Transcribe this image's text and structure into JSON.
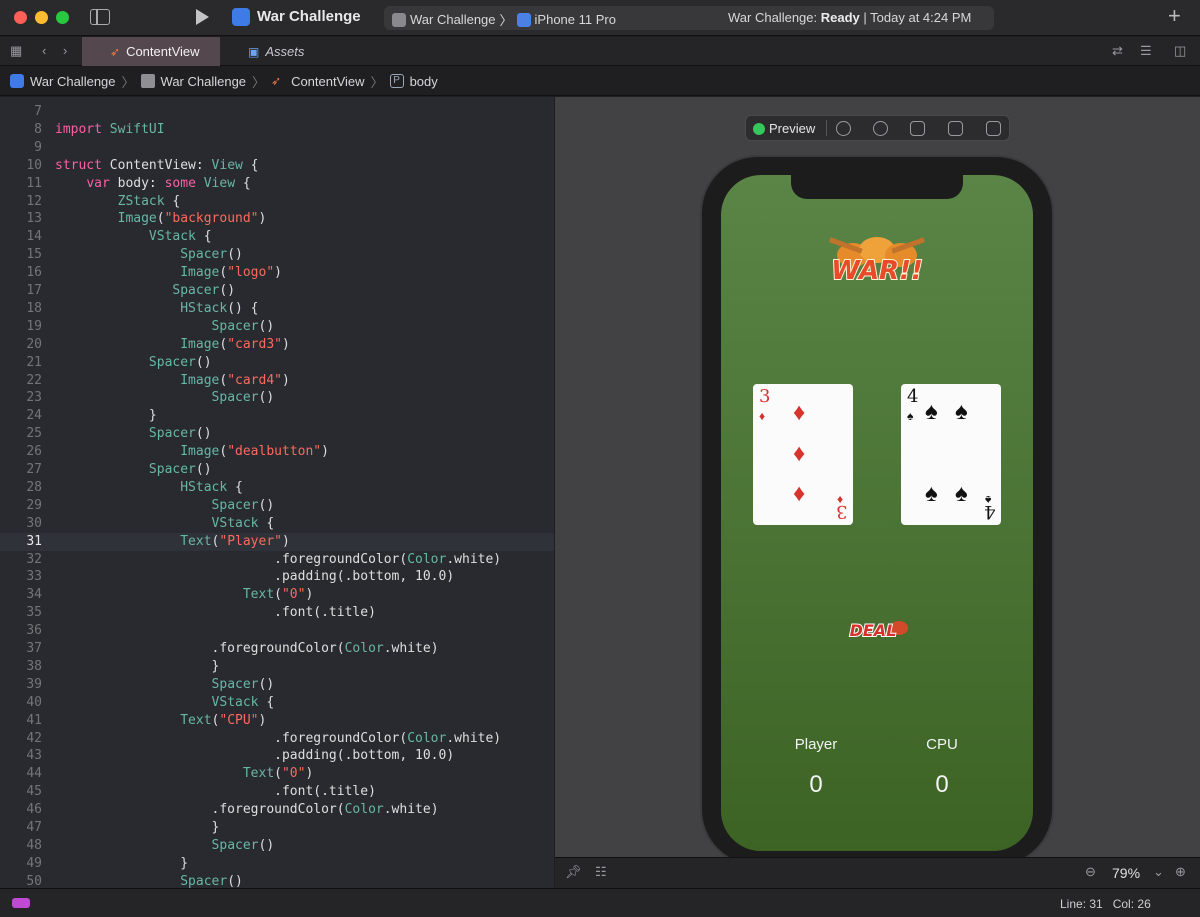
{
  "window": {
    "app_title": "War Challenge",
    "scheme": "War Challenge",
    "destination": "iPhone 11 Pro",
    "status_app": "War Challenge:",
    "status_state": "Ready",
    "status_time": "| Today at 4:24 PM"
  },
  "tabs": [
    {
      "label": "ContentView",
      "icon": "swift-icon"
    },
    {
      "label": "Assets",
      "icon": "assets-icon"
    }
  ],
  "breadcrumb": [
    "War Challenge",
    "War Challenge",
    "ContentView",
    "body"
  ],
  "editor": {
    "current_line": "31",
    "lines": [
      {
        "n": "7",
        "code": ""
      },
      {
        "n": "8",
        "code": "import SwiftUI"
      },
      {
        "n": "9",
        "code": ""
      },
      {
        "n": "10",
        "code": "struct ContentView: View {"
      },
      {
        "n": "11",
        "code": "    var body: some View {"
      },
      {
        "n": "12",
        "code": "        ZStack {"
      },
      {
        "n": "13",
        "code": "        Image(\"background\")"
      },
      {
        "n": "14",
        "code": "            VStack {"
      },
      {
        "n": "15",
        "code": "                Spacer()"
      },
      {
        "n": "16",
        "code": "                Image(\"logo\")"
      },
      {
        "n": "17",
        "code": "               Spacer()"
      },
      {
        "n": "18",
        "code": "                HStack() {"
      },
      {
        "n": "19",
        "code": "                    Spacer()"
      },
      {
        "n": "20",
        "code": "                Image(\"card3\")"
      },
      {
        "n": "21",
        "code": "            Spacer()"
      },
      {
        "n": "22",
        "code": "                Image(\"card4\")"
      },
      {
        "n": "23",
        "code": "                    Spacer()"
      },
      {
        "n": "24",
        "code": "            }"
      },
      {
        "n": "25",
        "code": "            Spacer()"
      },
      {
        "n": "26",
        "code": "                Image(\"dealbutton\")"
      },
      {
        "n": "27",
        "code": "            Spacer()"
      },
      {
        "n": "28",
        "code": "                HStack {"
      },
      {
        "n": "29",
        "code": "                    Spacer()"
      },
      {
        "n": "30",
        "code": "                    VStack {"
      },
      {
        "n": "31",
        "code": "                Text(\"Player\")"
      },
      {
        "n": "32",
        "code": "                            .foregroundColor(Color.white)"
      },
      {
        "n": "33",
        "code": "                            .padding(.bottom, 10.0)"
      },
      {
        "n": "34",
        "code": "                        Text(\"0\")"
      },
      {
        "n": "35",
        "code": "                            .font(.title)"
      },
      {
        "n": "36",
        "code": ""
      },
      {
        "n": "37",
        "code": "                    .foregroundColor(Color.white)"
      },
      {
        "n": "38",
        "code": "                    }"
      },
      {
        "n": "39",
        "code": "                    Spacer()"
      },
      {
        "n": "40",
        "code": "                    VStack {"
      },
      {
        "n": "41",
        "code": "                Text(\"CPU\")"
      },
      {
        "n": "42",
        "code": "                            .foregroundColor(Color.white)"
      },
      {
        "n": "43",
        "code": "                            .padding(.bottom, 10.0)"
      },
      {
        "n": "44",
        "code": "                        Text(\"0\")"
      },
      {
        "n": "45",
        "code": "                            .font(.title)"
      },
      {
        "n": "46",
        "code": "                    .foregroundColor(Color.white)"
      },
      {
        "n": "47",
        "code": "                    }"
      },
      {
        "n": "48",
        "code": "                    Spacer()"
      },
      {
        "n": "49",
        "code": "                }"
      },
      {
        "n": "50",
        "code": "                Spacer()"
      }
    ]
  },
  "preview": {
    "label": "Preview",
    "logo_text": "WAR!!",
    "card_left": {
      "rank": "3",
      "suit": "♦"
    },
    "card_right": {
      "rank": "4",
      "suit": "♠"
    },
    "deal_text": "DEAL",
    "player_label": "Player",
    "cpu_label": "CPU",
    "player_score": "0",
    "cpu_score": "0"
  },
  "canvas": {
    "zoom": "79%"
  },
  "statusbar": {
    "line": "Line: 31",
    "col": "Col: 26"
  },
  "colors": {
    "keyword": "#fc5fa3",
    "string": "#fc6a5d",
    "type": "#5dd8ff",
    "preview_dot": "#35c759",
    "felt_top": "#5a8547",
    "felt_bottom": "#3c6324"
  }
}
